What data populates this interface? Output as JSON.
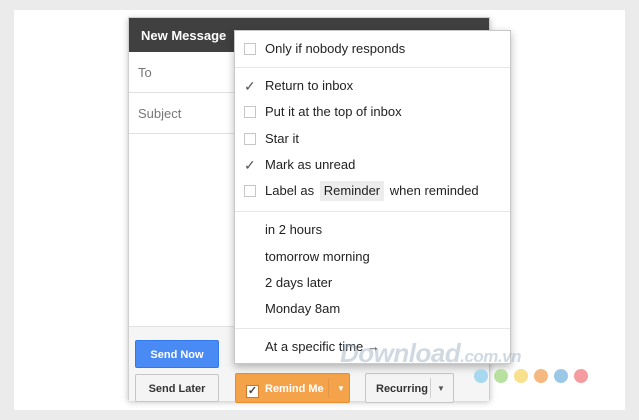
{
  "compose": {
    "title": "New Message",
    "to_label": "To",
    "subject_label": "Subject"
  },
  "buttons": {
    "send_now": "Send Now",
    "send_later": "Send Later",
    "remind_me": "Remind Me",
    "recurring": "Recurring"
  },
  "menu": {
    "options": [
      {
        "label": "Only if nobody responds",
        "checked": false
      },
      {
        "label": "Return to inbox",
        "checked": true
      },
      {
        "label": "Put it at the top of inbox",
        "checked": false
      },
      {
        "label": "Star it",
        "checked": false
      },
      {
        "label": "Mark as unread",
        "checked": true
      },
      {
        "label_prefix": "Label as",
        "tag": "Reminder",
        "label_suffix": "when reminded",
        "checked": false
      }
    ],
    "times": [
      "in 2 hours",
      "tomorrow morning",
      "2 days later",
      "Monday 8am"
    ],
    "specific_time": "At a specific time →"
  },
  "watermark": {
    "text": "Download",
    "suffix": ".com.vn",
    "dot_colors": [
      "#a8d8f0",
      "#b8e0a0",
      "#f8e08c",
      "#f4b880",
      "#9cc8e8",
      "#f49ca0"
    ]
  },
  "colors": {
    "header_bg": "#404040",
    "send_now_bg": "#4a8af4",
    "remind_me_bg": "#f5a34a"
  }
}
